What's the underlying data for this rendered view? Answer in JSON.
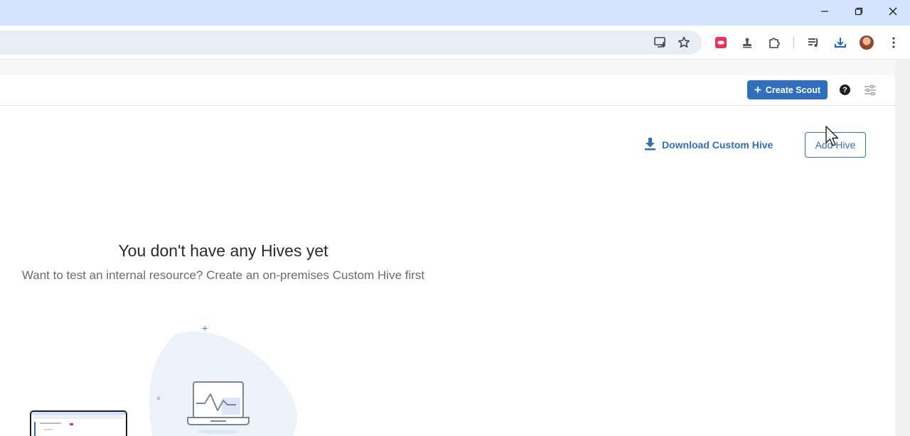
{
  "window": {
    "minimize_icon": "minimize-icon",
    "restore_icon": "restore-icon",
    "close_icon": "close-icon"
  },
  "toolbar": {
    "icons": [
      "install-app-icon",
      "bookmark-star-icon",
      "extension-red-icon",
      "extension-stamp-icon",
      "extensions-puzzle-icon",
      "media-control-icon",
      "downloads-icon",
      "profile-avatar",
      "more-menu-icon"
    ]
  },
  "header": {
    "create_scout_label": "Create Scout",
    "help_icon": "help-icon",
    "settings_icon": "settings-sliders-icon"
  },
  "actions": {
    "download_label": "Download Custom Hive",
    "add_hive_label": "Add Hive"
  },
  "empty_state": {
    "title": "You don't have any Hives yet",
    "subtitle": "Want to test an internal resource? Create an on-premises Custom Hive first"
  },
  "colors": {
    "accent": "#2f6fbd",
    "titlebar": "#d3e3fd",
    "omnibox": "#e9eef6"
  }
}
